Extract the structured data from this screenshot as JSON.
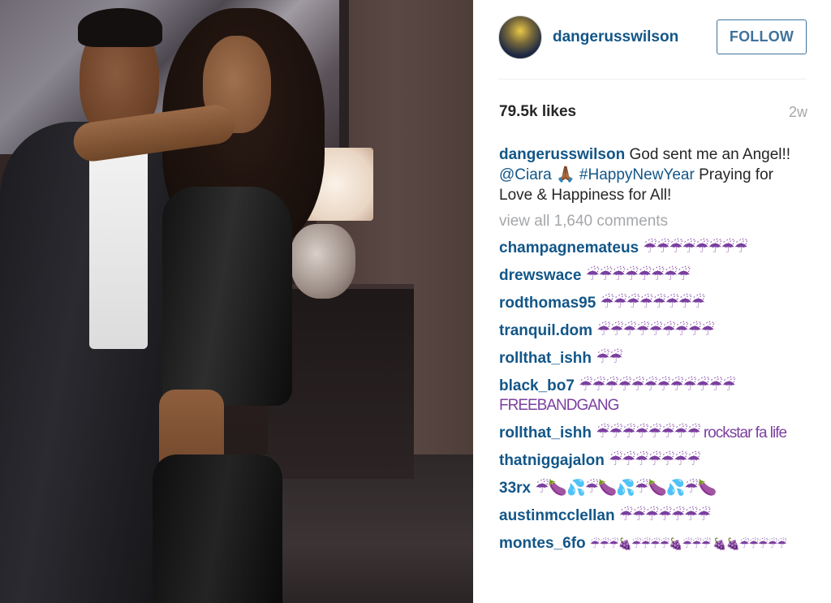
{
  "post": {
    "username": "dangerusswilson",
    "follow_label": "FOLLOW",
    "likes": "79.5k likes",
    "time_ago": "2w",
    "caption": {
      "username": "dangerusswilson",
      "text_before": " God sent me an Angel!! ",
      "mention": "@Ciara",
      "emoji": " 🙏🏾 ",
      "hashtag": "#HappyNewYear",
      "text_after": " Praying for Love & Happiness for All!"
    },
    "view_all_comments": "view all 1,640 comments",
    "comments": [
      {
        "username": "champagnemateus",
        "text": "☔☔☔☔☔☔☔☔"
      },
      {
        "username": "drewswace",
        "text": "☔☔☔☔☔☔☔☔"
      },
      {
        "username": "rodthomas95",
        "text": "☔☔☔☔☔☔☔☔"
      },
      {
        "username": "tranquil.dom",
        "text": "☔☔☔☔☔☔☔☔☔"
      },
      {
        "username": "rollthat_ishh",
        "text": "☔☔"
      },
      {
        "username": "black_bo7",
        "text": "☔☔☔☔☔☔☔☔☔☔☔☔ FREEBANDGANG"
      },
      {
        "username": "rollthat_ishh",
        "text": "☔☔☔☔☔☔☔☔ rockstar fa life"
      },
      {
        "username": "thatniggajalon",
        "text": "☔☔☔☔☔☔☔"
      },
      {
        "username": "33rx",
        "text": "☔🍆💦☔🍆💦☔🍆💦☔🍆"
      },
      {
        "username": "austinmcclellan",
        "text": "☔☔☔☔☔☔☔"
      },
      {
        "username": "montes_6fo",
        "text": "☔☔☔🍇☔☔☔☔🍇☔☔☔ 🍇🍇☔☔☔☔☔"
      }
    ]
  }
}
